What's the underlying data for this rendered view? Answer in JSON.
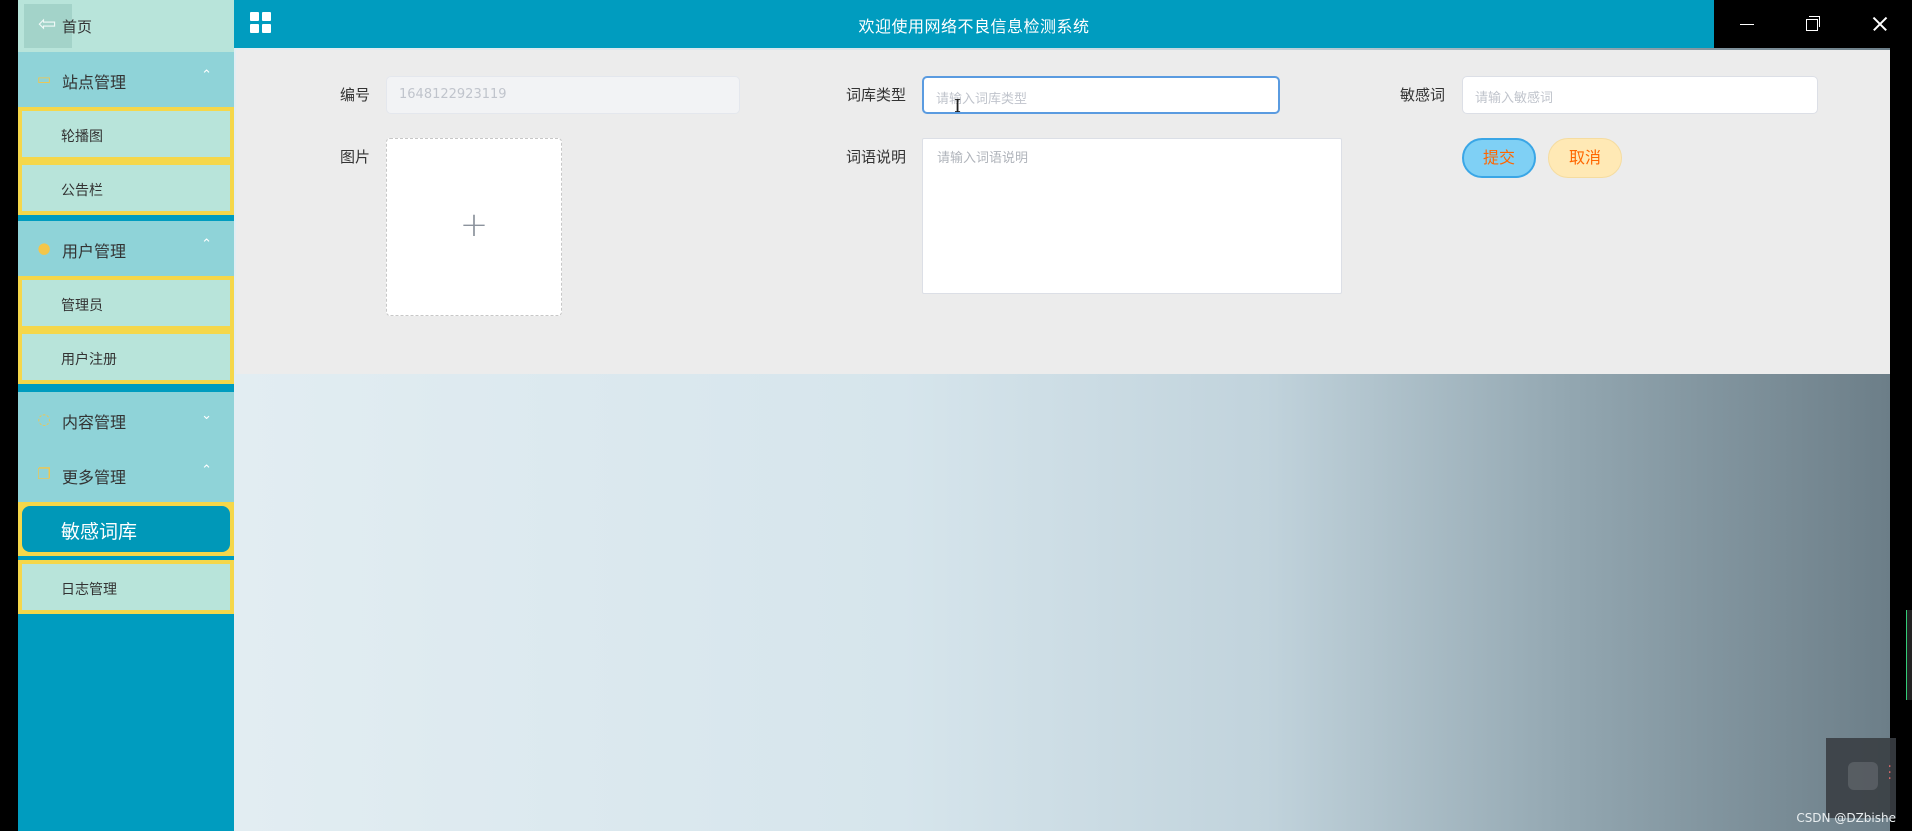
{
  "header": {
    "title": "欢迎使用网络不良信息检测系统"
  },
  "sidebar": {
    "home_label": "首页",
    "back_glyph": "⇦",
    "groups": [
      {
        "label": "站点管理",
        "icon": "monitor-icon",
        "glyph": "▭",
        "chevron": "⌃",
        "items": [
          {
            "label": "轮播图"
          },
          {
            "label": "公告栏"
          }
        ]
      },
      {
        "label": "用户管理",
        "icon": "user-icon",
        "glyph": "●",
        "chevron": "⌃",
        "items": [
          {
            "label": "管理员"
          },
          {
            "label": "用户注册"
          }
        ]
      },
      {
        "label": "内容管理",
        "icon": "chat-icon",
        "glyph": "◌",
        "chevron": "⌄",
        "items": []
      },
      {
        "label": "更多管理",
        "icon": "copy-icon",
        "glyph": "❐",
        "chevron": "⌃",
        "items": [
          {
            "label": "敏感词库",
            "active": true
          },
          {
            "label": "日志管理"
          }
        ]
      }
    ]
  },
  "form": {
    "id_label": "编号",
    "id_value": "1648122923119",
    "type_label": "词库类型",
    "type_placeholder": "请输入词库类型",
    "word_label": "敏感词",
    "word_placeholder": "请输入敏感词",
    "image_label": "图片",
    "upload_glyph": "+",
    "desc_label": "词语说明",
    "desc_placeholder": "请输入词语说明",
    "submit_label": "提交",
    "cancel_label": "取消"
  },
  "watermark": "CSDN @DZbishe",
  "colors": {
    "primary": "#009cbf",
    "sidebar_item_bg": "#b8e4da",
    "sidebar_border": "#f5d74a",
    "submit_text": "#ff6600"
  }
}
